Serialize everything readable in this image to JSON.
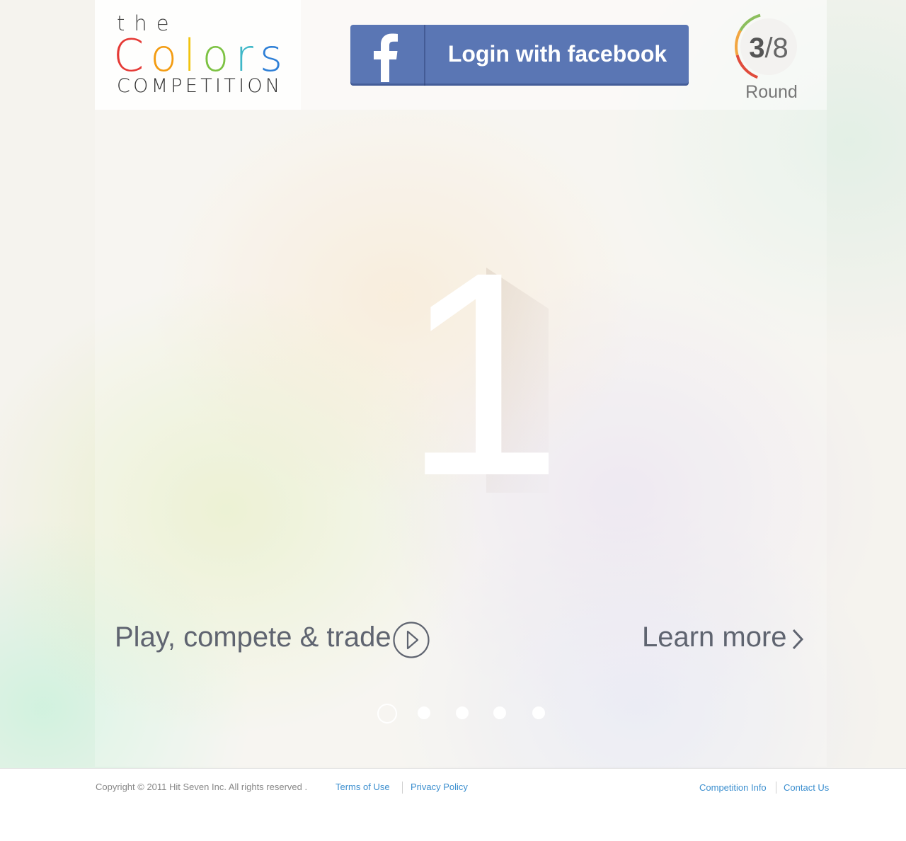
{
  "logo": {
    "the": "the",
    "colors_letters": [
      {
        "ch": "C",
        "color": "#e53935"
      },
      {
        "ch": "o",
        "color": "#f39c12"
      },
      {
        "ch": "l",
        "color": "#f1c40f"
      },
      {
        "ch": "o",
        "color": "#7cc242"
      },
      {
        "ch": "r",
        "color": "#3fb7c8"
      },
      {
        "ch": "s",
        "color": "#2e7fd6"
      }
    ],
    "competition": "COMPETITION"
  },
  "facebook": {
    "label": "Login with facebook",
    "color": "#5a76b4"
  },
  "round": {
    "current": "3",
    "total": "/8",
    "label": "Round",
    "progress": 0.375
  },
  "hero": {
    "number": "1"
  },
  "cta": {
    "tagline": "Play, compete & trade",
    "learn_more": "Learn more"
  },
  "carousel": {
    "slides": 5,
    "active": 0
  },
  "footer": {
    "copyright": "Copyright  © 2011  Hit Seven Inc. All rights reserved .",
    "terms": "Terms  of Use",
    "privacy": "Privacy Policy",
    "competition_info": "Competition  Info",
    "contact": "Contact  Us",
    "link_color": "#3c8fcf"
  }
}
